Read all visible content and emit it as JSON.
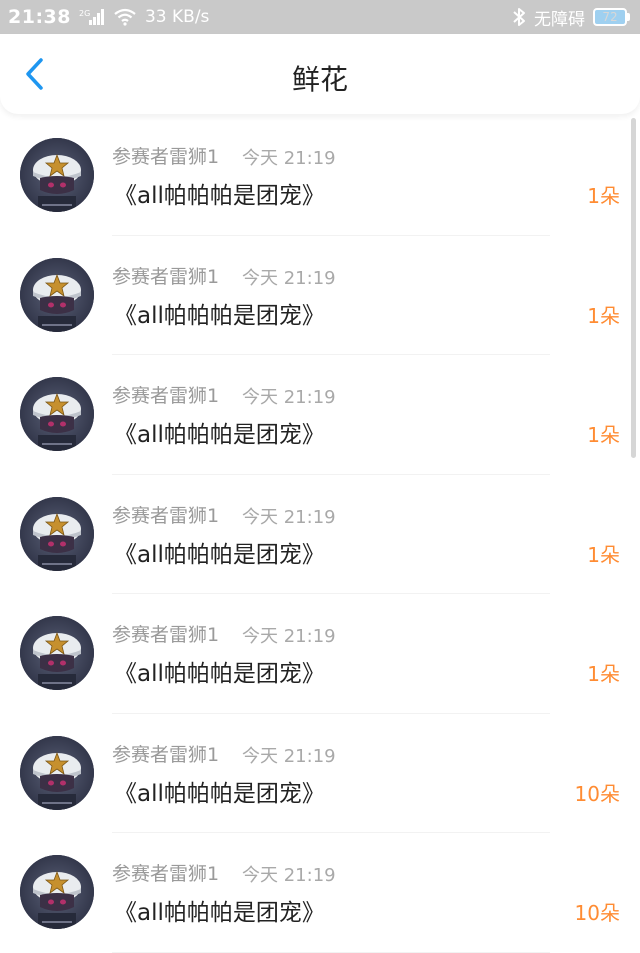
{
  "status_bar": {
    "time": "21:38",
    "network": "2G",
    "speed": "33 KB/s",
    "accessibility": "无障碍",
    "battery": "72",
    "colors": {
      "background": "#c9c9c9",
      "text": "#ffffff"
    }
  },
  "header": {
    "back_icon": "chevron-left-icon",
    "title": "鲜花",
    "accent": "#1e96f0"
  },
  "list": {
    "items": [
      {
        "user": "参赛者雷狮1",
        "time": "今天 21:19",
        "book": "《all帕帕帕是团宠》",
        "count": "1朵"
      },
      {
        "user": "参赛者雷狮1",
        "time": "今天 21:19",
        "book": "《all帕帕帕是团宠》",
        "count": "1朵"
      },
      {
        "user": "参赛者雷狮1",
        "time": "今天 21:19",
        "book": "《all帕帕帕是团宠》",
        "count": "1朵"
      },
      {
        "user": "参赛者雷狮1",
        "time": "今天 21:19",
        "book": "《all帕帕帕是团宠》",
        "count": "1朵"
      },
      {
        "user": "参赛者雷狮1",
        "time": "今天 21:19",
        "book": "《all帕帕帕是团宠》",
        "count": "1朵"
      },
      {
        "user": "参赛者雷狮1",
        "time": "今天 21:19",
        "book": "《all帕帕帕是团宠》",
        "count": "10朵"
      },
      {
        "user": "参赛者雷狮1",
        "time": "今天 21:19",
        "book": "《all帕帕帕是团宠》",
        "count": "10朵"
      }
    ],
    "count_color": "#ff8c33"
  }
}
